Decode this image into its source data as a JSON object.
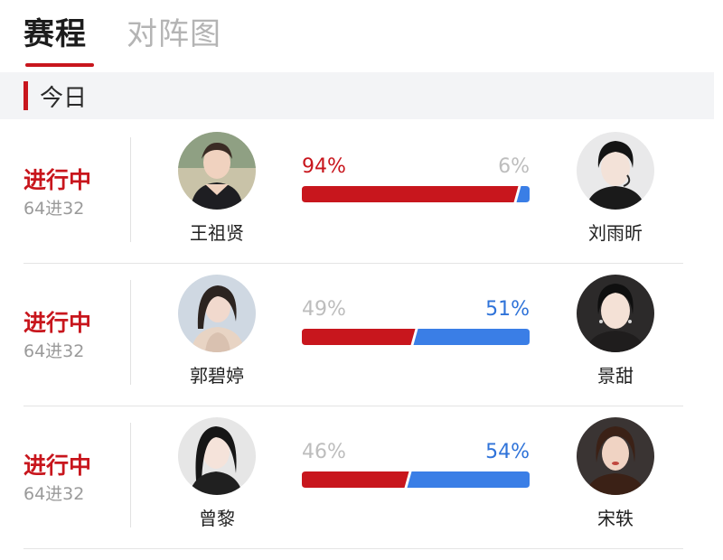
{
  "tabs": {
    "schedule": "赛程",
    "bracket": "对阵图"
  },
  "section": {
    "title": "今日"
  },
  "colors": {
    "accent_red": "#c8161d",
    "bar_red": "#c8161d",
    "bar_blue": "#3a7ee6",
    "leading_left": "#c8161d",
    "leading_right": "#2f73d9",
    "trailing": "#bdbdbd"
  },
  "matches": [
    {
      "status": "进行中",
      "round": "64进32",
      "left": {
        "name": "王祖贤",
        "pct_label": "94%",
        "share": 0.94
      },
      "right": {
        "name": "刘雨昕",
        "pct_label": "6%",
        "share": 0.06
      }
    },
    {
      "status": "进行中",
      "round": "64进32",
      "left": {
        "name": "郭碧婷",
        "pct_label": "49%",
        "share": 0.49
      },
      "right": {
        "name": "景甜",
        "pct_label": "51%",
        "share": 0.51
      }
    },
    {
      "status": "进行中",
      "round": "64进32",
      "left": {
        "name": "曾黎",
        "pct_label": "46%",
        "share": 0.46
      },
      "right": {
        "name": "宋轶",
        "pct_label": "54%",
        "share": 0.54
      }
    }
  ]
}
